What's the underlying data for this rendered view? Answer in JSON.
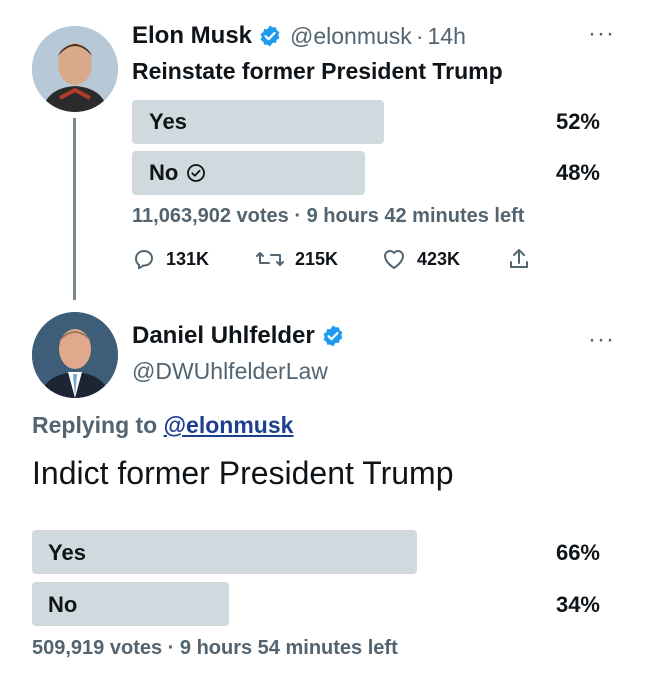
{
  "tweet1": {
    "author_name": "Elon Musk",
    "handle": "@elonmusk",
    "time": "14h",
    "text": "Reinstate former President Trump",
    "poll": {
      "options": [
        {
          "label": "Yes",
          "percent": "52%",
          "fraction": 0.52
        },
        {
          "label": "No",
          "percent": "48%",
          "fraction": 0.48
        }
      ],
      "votes": "11,063,902 votes",
      "time_left": "9 hours 42 minutes left"
    },
    "actions": {
      "replies": "131K",
      "retweets": "215K",
      "likes": "423K"
    },
    "more_icon": "more-horizontal-icon",
    "verified_color": "#1d9bf0"
  },
  "tweet2": {
    "author_name": "Daniel Uhlfelder",
    "handle": "@DWUhlfelderLaw",
    "replying_prefix": "Replying to",
    "replying_handle": "@elonmusk",
    "text": "Indict former President Trump",
    "poll": {
      "options": [
        {
          "label": "Yes",
          "percent": "66%",
          "fraction": 0.66
        },
        {
          "label": "No",
          "percent": "34%",
          "fraction": 0.34
        }
      ],
      "votes": "509,919 votes",
      "time_left": "9 hours 54 minutes left"
    }
  },
  "colors": {
    "bar": "#cfd9de",
    "secondary_text": "#536471",
    "link": "#1d3f8f"
  }
}
